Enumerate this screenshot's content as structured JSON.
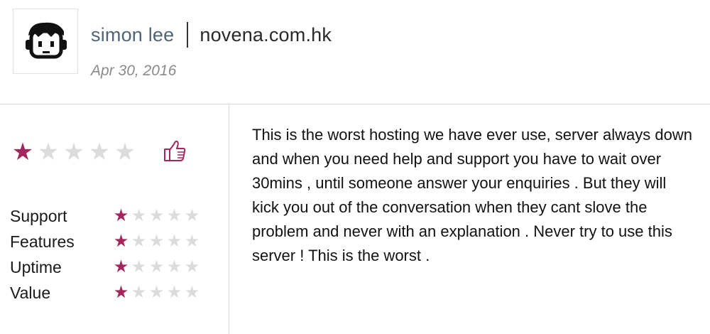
{
  "author": {
    "name": "simon lee",
    "company": "novena.com.hk",
    "date": "Apr 30, 2016"
  },
  "rating": {
    "overall": 1,
    "max": 5,
    "star_on_color": "#a3275d",
    "star_off_color": "#dcdcdc",
    "like_icon": "thumbs-up-icon"
  },
  "categories": [
    {
      "label": "Support",
      "rating": 1
    },
    {
      "label": "Features",
      "rating": 1
    },
    {
      "label": "Uptime",
      "rating": 1
    },
    {
      "label": "Value",
      "rating": 1
    }
  ],
  "review": {
    "text": "This is the worst hosting we have ever use, server always down and when you need help and support you have to wait over 30mins , until someone answer your enquiries . But they will kick you out of the conversation when they cant slove the problem and never with an explanation . Never try to use this server ! This is the worst ."
  }
}
